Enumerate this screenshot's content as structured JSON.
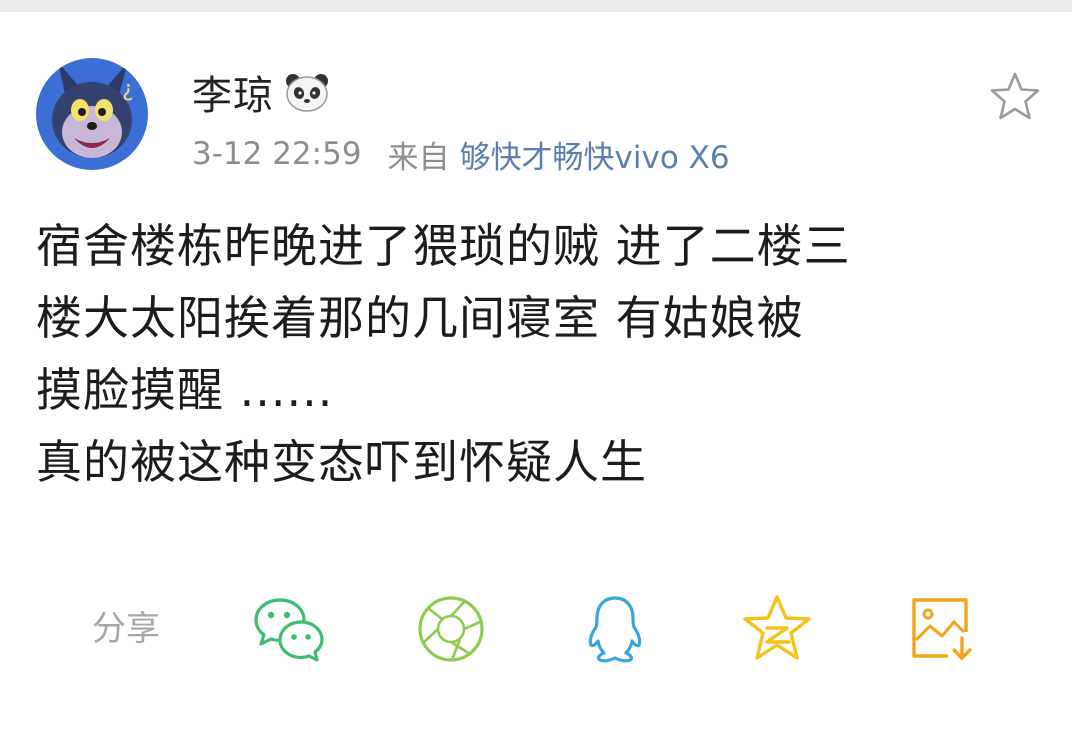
{
  "post": {
    "username": "李琼",
    "timestamp": "3-12 22:59",
    "source_prefix": "来自",
    "source_device": "够快才畅快vivo X6",
    "body_lines": [
      "宿舍楼栋昨晚进了猥琐的贼 进了二楼三",
      "楼大太阳挨着那的几间寝室   有姑娘被",
      "摸脸摸醒  ......",
      "真的被这种变态吓到怀疑人生"
    ]
  },
  "share": {
    "label": "分享",
    "targets": [
      {
        "name": "wechat",
        "color": "#3dbc74"
      },
      {
        "name": "moments",
        "color": "#8ecb4f"
      },
      {
        "name": "qq",
        "color": "#38a5de"
      },
      {
        "name": "qzone",
        "color": "#f2c31b"
      },
      {
        "name": "save-image",
        "color": "#f0a51a"
      }
    ]
  },
  "icons": {
    "favorite": "star-outline-icon",
    "badge": "panda-icon"
  }
}
